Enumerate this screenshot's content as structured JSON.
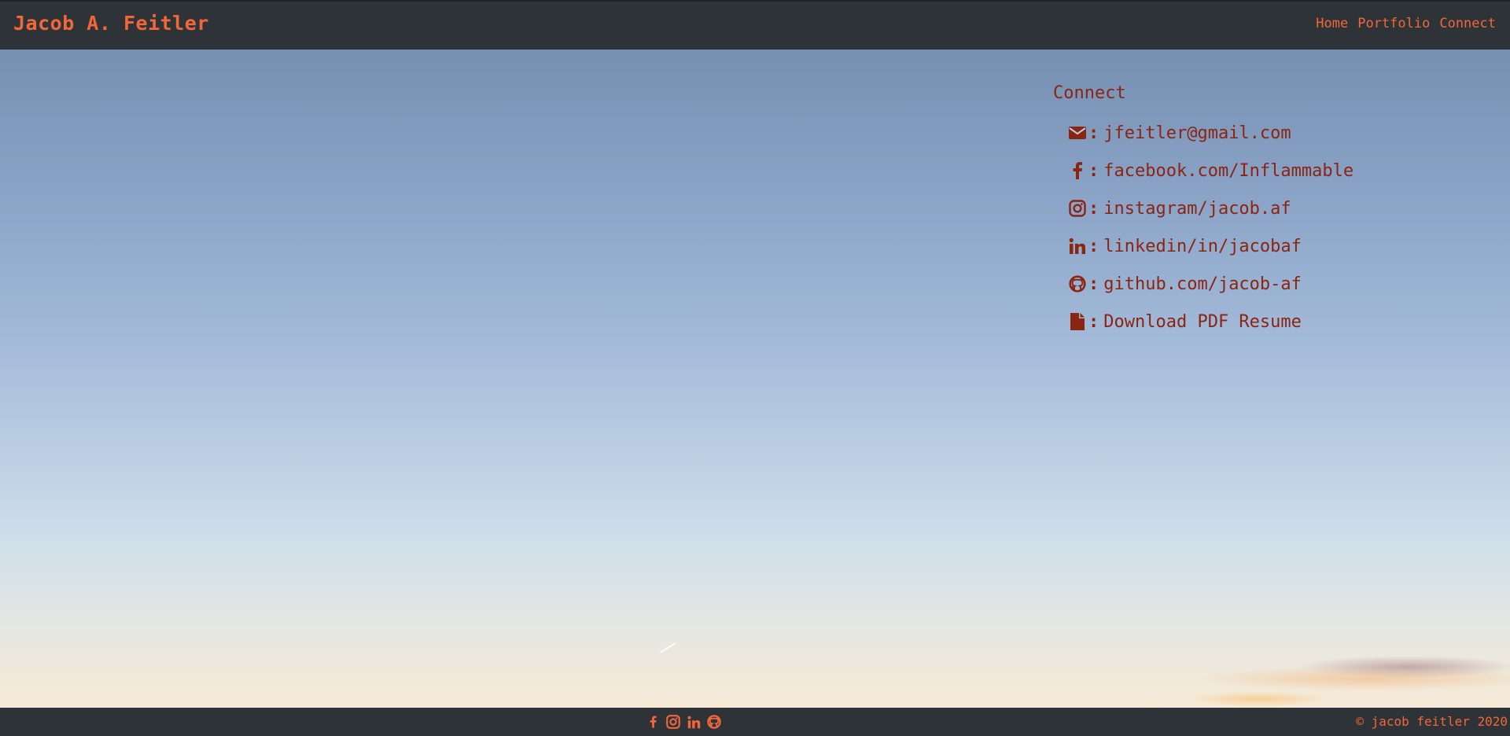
{
  "header": {
    "brand": "Jacob A. Feitler",
    "nav": [
      "Home",
      "Portfolio",
      "Connect"
    ]
  },
  "connect": {
    "title": "Connect",
    "items": [
      {
        "icon": "envelope-icon",
        "sep": ":",
        "label": "jfeitler@gmail.com"
      },
      {
        "icon": "facebook-icon",
        "sep": ":",
        "label": "facebook.com/Inflammable"
      },
      {
        "icon": "instagram-icon",
        "sep": ":",
        "label": "instagram/jacob.af"
      },
      {
        "icon": "linkedin-icon",
        "sep": ":",
        "label": "linkedin/in/jacobaf"
      },
      {
        "icon": "github-icon",
        "sep": ":",
        "label": "github.com/jacob-af"
      },
      {
        "icon": "file-icon",
        "sep": " :",
        "label": "Download PDF Resume"
      }
    ]
  },
  "footer": {
    "social_icons": [
      "facebook-icon",
      "instagram-icon",
      "linkedin-icon",
      "github-icon"
    ],
    "copyright": "© jacob feitler 2020"
  },
  "colors": {
    "bar": "#2e3338",
    "accent": "#f2673a",
    "link": "#8a2512"
  }
}
